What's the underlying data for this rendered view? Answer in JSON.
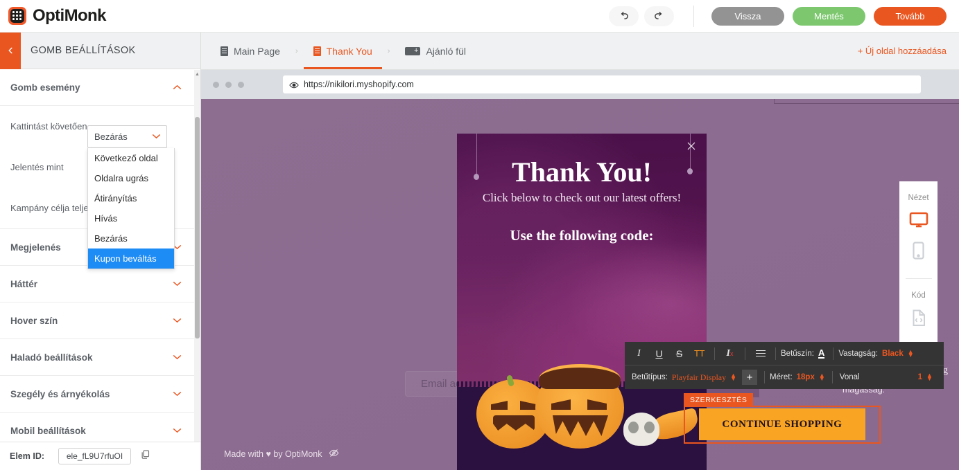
{
  "topbar": {
    "logo_text": "OptiMonk",
    "undo_icon": "undo-icon",
    "redo_icon": "redo-icon",
    "buttons": {
      "back": "Vissza",
      "save": "Mentés",
      "next": "Tovább"
    },
    "colors": {
      "back": "#939393",
      "save": "#7dc86f",
      "next": "#ea5620",
      "brand": "#f1582a"
    }
  },
  "sidebar": {
    "title": "GOMB BEÁLLÍTÁSOK",
    "back_icon": "chevron-left-icon",
    "sections": [
      {
        "label": "Gomb esemény",
        "state": "expanded",
        "icon": "chevron-up-icon"
      },
      {
        "label": "Megjelenés",
        "state": "collapsed",
        "icon": "chevron-down-icon"
      },
      {
        "label": "Háttér",
        "state": "collapsed",
        "icon": "chevron-down-icon"
      },
      {
        "label": "Hover szín",
        "state": "collapsed",
        "icon": "chevron-down-icon"
      },
      {
        "label": "Haladó beállítások",
        "state": "collapsed",
        "icon": "chevron-down-icon"
      },
      {
        "label": "Szegély és árnyékolás",
        "state": "collapsed",
        "icon": "chevron-down-icon"
      },
      {
        "label": "Mobil beállítások",
        "state": "collapsed",
        "icon": "chevron-down-icon"
      }
    ],
    "fields": [
      {
        "label": "Kattintást követően"
      },
      {
        "label": "Jelentés mint"
      },
      {
        "label": "Kampány célja telje"
      }
    ],
    "element_id": {
      "label": "Elem ID:",
      "value": "ele_fL9U7rfuOI",
      "copy_icon": "copy-icon"
    }
  },
  "dropdown": {
    "selected": "Bezárás",
    "chevron_icon": "chevron-down-icon",
    "options": [
      "Következő oldal",
      "Oldalra ugrás",
      "Átirányítás",
      "Hívás",
      "Bezárás",
      "Kupon beváltás"
    ],
    "highlighted": "Kupon beváltás",
    "highlight_color": "#1e8cf5"
  },
  "tabs": {
    "items": [
      {
        "label": "Main Page",
        "icon": "page-icon",
        "active": false
      },
      {
        "label": "Thank You",
        "icon": "page-icon",
        "active": true
      },
      {
        "label": "Ajánló fül",
        "icon": "teaser-tab-icon",
        "active": false
      }
    ],
    "separator": "›",
    "add_page": "+ Új oldal hozzáadása"
  },
  "browser": {
    "url": "https://nikilori.myshopify.com",
    "eye_icon": "eye-icon",
    "dots_icon": "window-dots-icon"
  },
  "popup": {
    "close_icon": "close-icon",
    "title": "Thank You!",
    "subtitle": "Click below to check out our latest offers!",
    "code_heading": "Use the following code:",
    "cta_label": "CONTINUE SHOPPING",
    "edit_badge": "SZERKESZTÉS",
    "cta_color": "#f9a422",
    "selection_color": "#ea5620"
  },
  "page_behind": {
    "email_placeholder": "Email ac",
    "notify_button": "TIFY ME",
    "height_label": "magasság:",
    "partial_text": "ng",
    "footer": "Made with ♥ by OptiMonk",
    "footer_eye_icon": "eye-off-icon"
  },
  "rich_text_toolbar": {
    "italic_icon": "italic-icon",
    "underline_icon": "underline-icon",
    "strikethrough_icon": "strikethrough-icon",
    "uppercase_label": "TT",
    "clear_format_icon": "clear-format-icon",
    "align_icon": "align-icon",
    "font_color_label": "Betűszín:",
    "font_color_icon": "font-color-A-icon",
    "weight_label": "Vastagság:",
    "weight_value": "Black",
    "font_family_label": "Betűtípus:",
    "font_family_value": "Playfair Display",
    "add_font_label": "+",
    "size_label": "Méret:",
    "size_value": "18px",
    "line_label": "Vonal",
    "line_value": "1",
    "accent": "#ea5620"
  },
  "device_panel": {
    "view_label": "Nézet",
    "desktop_icon": "desktop-icon",
    "mobile_icon": "mobile-icon",
    "code_label": "Kód",
    "code_icon": "code-file-icon",
    "active": "desktop"
  }
}
